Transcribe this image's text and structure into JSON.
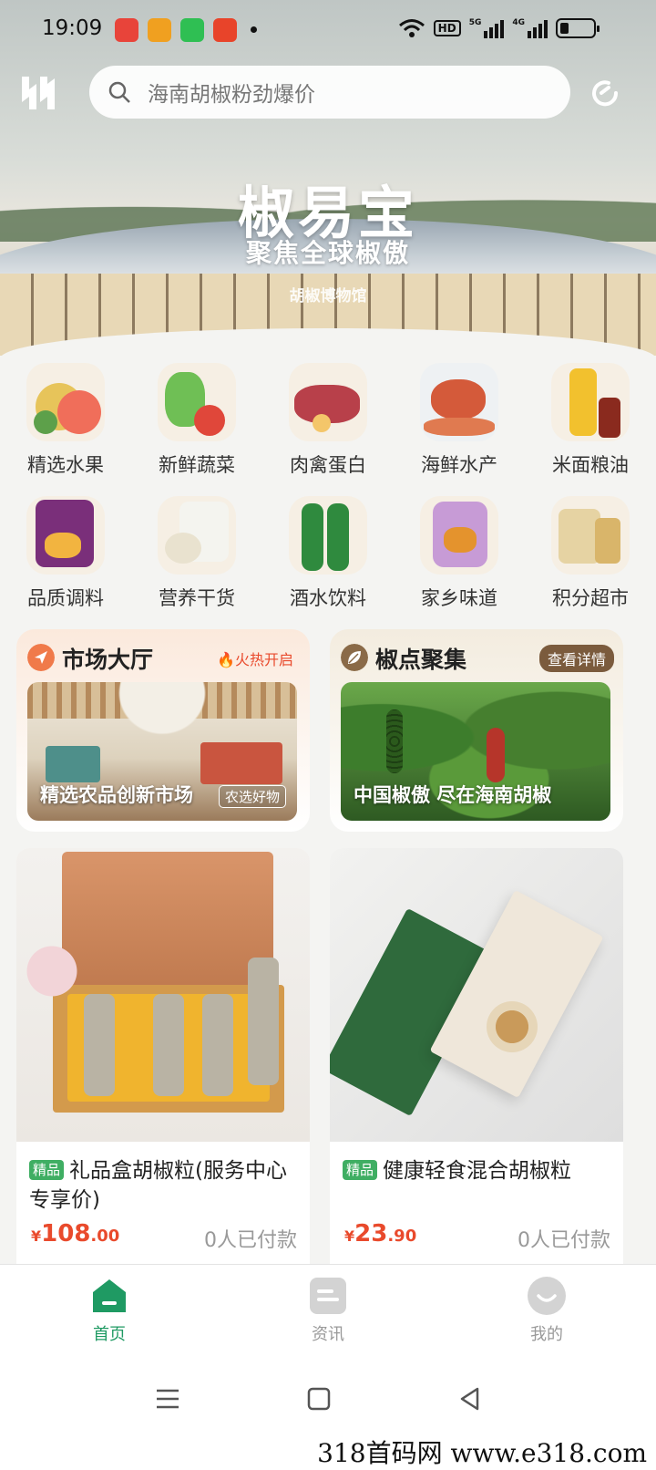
{
  "status": {
    "time": "19:09",
    "hd": "HD",
    "net1": "5G",
    "net2": "4G"
  },
  "header": {
    "search_placeholder": "海南胡椒粉劲爆价"
  },
  "hero": {
    "title": "椒易宝",
    "subtitle": "聚焦全球椒傲",
    "museum": "胡椒博物馆"
  },
  "categories": [
    {
      "label": "精选水果",
      "icon": "fruit-icon"
    },
    {
      "label": "新鲜蔬菜",
      "icon": "vegetable-icon"
    },
    {
      "label": "肉禽蛋白",
      "icon": "meat-icon"
    },
    {
      "label": "海鲜水产",
      "icon": "seafood-icon"
    },
    {
      "label": "米面粮油",
      "icon": "grain-oil-icon"
    },
    {
      "label": "品质调料",
      "icon": "seasoning-icon"
    },
    {
      "label": "营养干货",
      "icon": "dried-goods-icon"
    },
    {
      "label": "酒水饮料",
      "icon": "drinks-icon"
    },
    {
      "label": "家乡味道",
      "icon": "hometown-food-icon"
    },
    {
      "label": "积分超市",
      "icon": "points-market-icon"
    }
  ],
  "market": {
    "title": "市场大厅",
    "badge": "火热开启",
    "caption": "精选农品创新市场",
    "tag": "农选好物"
  },
  "pepper": {
    "title": "椒点聚集",
    "badge": "查看详情",
    "caption": "中国椒傲  尽在海南胡椒"
  },
  "products": [
    {
      "tag": "精品",
      "name": "礼品盒胡椒粒(服务中心专享价)",
      "currency": "¥",
      "price_int": "108",
      "price_dec": ".00",
      "sold": "0人已付款"
    },
    {
      "tag": "精品",
      "name": "健康轻食混合胡椒粒",
      "currency": "¥",
      "price_int": "23",
      "price_dec": ".90",
      "sold": "0人已付款"
    }
  ],
  "tabs": [
    {
      "label": "首页",
      "icon": "home-icon",
      "active": true
    },
    {
      "label": "资讯",
      "icon": "news-icon",
      "active": false
    },
    {
      "label": "我的",
      "icon": "profile-icon",
      "active": false
    }
  ],
  "watermark": "318首码网  www.e318.com",
  "colors": {
    "accent": "#1f9a63",
    "price": "#e94a2c",
    "tag": "#3fae63"
  }
}
